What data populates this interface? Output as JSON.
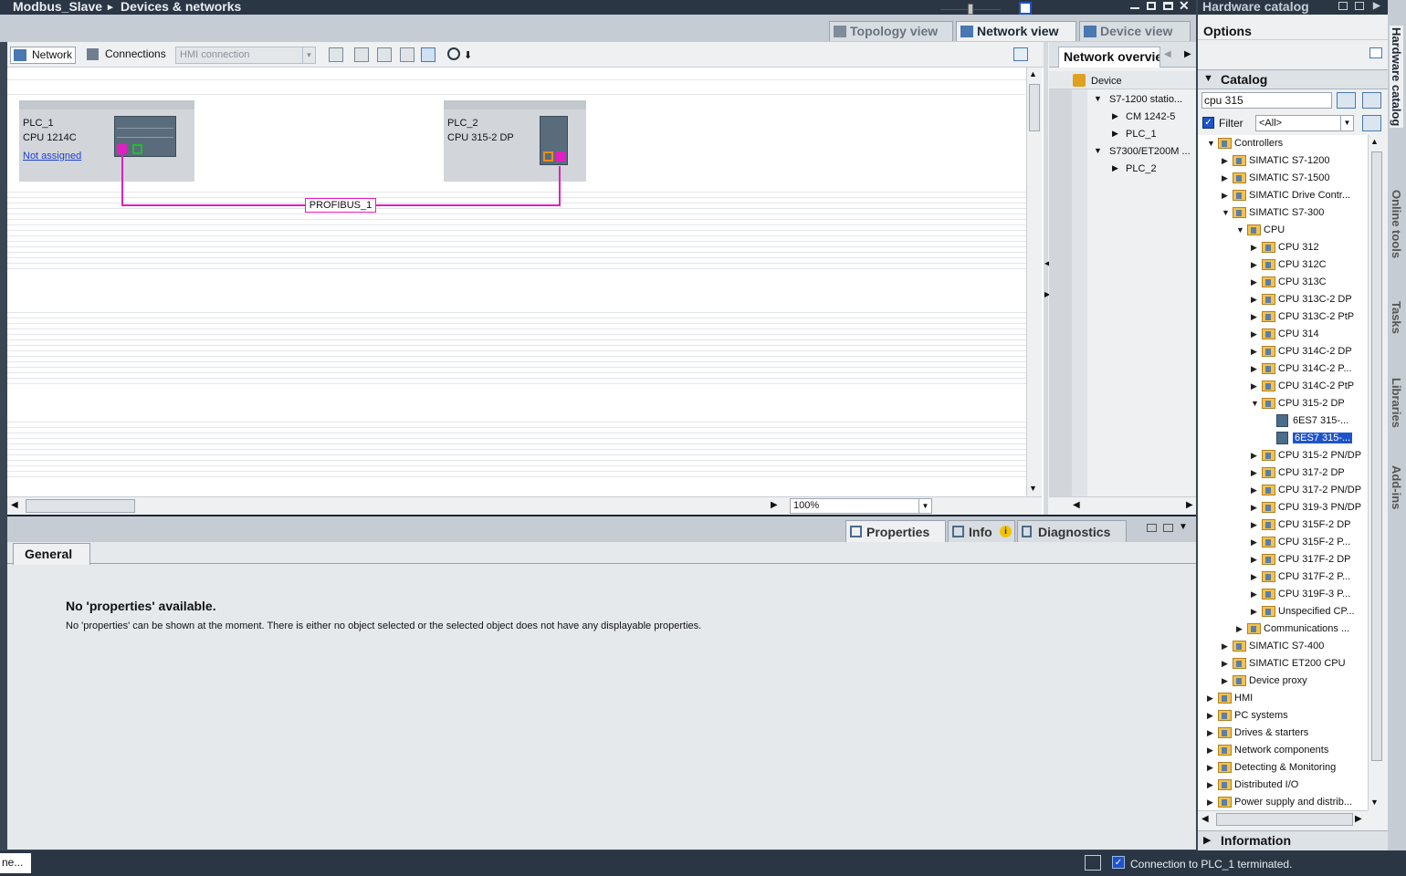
{
  "titlebar": {
    "project": "Modbus_Slave",
    "separator": "▸",
    "page": "Devices & networks",
    "min_icon": "minimize-icon",
    "close": "✕"
  },
  "view_tabs": [
    {
      "label": "Topology view",
      "icon": "topology-icon"
    },
    {
      "label": "Network view",
      "icon": "network-icon"
    },
    {
      "label": "Device view",
      "icon": "device-icon"
    }
  ],
  "toolbar": {
    "network_label": "Network",
    "connections_label": "Connections",
    "connection_type": "HMI connection"
  },
  "devices": [
    {
      "name": "PLC_1",
      "type": "CPU 1214C",
      "link": "Not assigned"
    },
    {
      "name": "PLC_2",
      "type": "CPU 315-2 DP"
    }
  ],
  "network": {
    "subnet_label": "PROFIBUS_1",
    "line_color": "#e020c0"
  },
  "zoom": {
    "value": "100%"
  },
  "overview": {
    "tab_label": "Network overvie",
    "column": "Device",
    "rows": [
      {
        "label": "S7-1200 statio...",
        "expanded": true
      },
      {
        "label": "CM 1242-5"
      },
      {
        "label": "PLC_1"
      },
      {
        "label": "S7300/ET200M ...",
        "expanded": true
      },
      {
        "label": "PLC_2"
      }
    ]
  },
  "bottom_tabs": {
    "properties": "Properties",
    "info": "Info",
    "info_badge": "i",
    "diagnostics": "Diagnostics"
  },
  "properties": {
    "general_tab": "General",
    "heading": "No 'properties' available.",
    "message": "No 'properties' can be shown at the moment. There is either no object selected or the selected object does not have any displayable properties."
  },
  "hardware_catalog": {
    "title": "Hardware catalog",
    "options": "Options",
    "catalog_label": "Catalog",
    "search_value": "cpu 315",
    "filter_label": "Filter",
    "filter_checked": true,
    "filter_value": "<All>",
    "information": "Information",
    "tree": [
      {
        "label": "Controllers",
        "level": 0,
        "state": "open",
        "kind": "folder"
      },
      {
        "label": "SIMATIC S7-1200",
        "level": 1,
        "state": "closed",
        "kind": "folder"
      },
      {
        "label": "SIMATIC S7-1500",
        "level": 1,
        "state": "closed",
        "kind": "folder"
      },
      {
        "label": "SIMATIC Drive Contr...",
        "level": 1,
        "state": "closed",
        "kind": "folder"
      },
      {
        "label": "SIMATIC S7-300",
        "level": 1,
        "state": "open",
        "kind": "folder"
      },
      {
        "label": "CPU",
        "level": 2,
        "state": "open",
        "kind": "folder"
      },
      {
        "label": "CPU 312",
        "level": 3,
        "state": "closed",
        "kind": "folder"
      },
      {
        "label": "CPU 312C",
        "level": 3,
        "state": "closed",
        "kind": "folder"
      },
      {
        "label": "CPU 313C",
        "level": 3,
        "state": "closed",
        "kind": "folder"
      },
      {
        "label": "CPU 313C-2 DP",
        "level": 3,
        "state": "closed",
        "kind": "folder"
      },
      {
        "label": "CPU 313C-2 PtP",
        "level": 3,
        "state": "closed",
        "kind": "folder"
      },
      {
        "label": "CPU 314",
        "level": 3,
        "state": "closed",
        "kind": "folder"
      },
      {
        "label": "CPU 314C-2 DP",
        "level": 3,
        "state": "closed",
        "kind": "folder"
      },
      {
        "label": "CPU 314C-2 P...",
        "level": 3,
        "state": "closed",
        "kind": "folder"
      },
      {
        "label": "CPU 314C-2 PtP",
        "level": 3,
        "state": "closed",
        "kind": "folder"
      },
      {
        "label": "CPU 315-2 DP",
        "level": 3,
        "state": "open",
        "kind": "folder"
      },
      {
        "label": "6ES7 315-...",
        "level": 4,
        "state": "none",
        "kind": "module"
      },
      {
        "label": "6ES7 315-...",
        "level": 4,
        "state": "none",
        "kind": "module",
        "selected": true
      },
      {
        "label": "CPU 315-2 PN/DP",
        "level": 3,
        "state": "closed",
        "kind": "folder"
      },
      {
        "label": "CPU 317-2 DP",
        "level": 3,
        "state": "closed",
        "kind": "folder"
      },
      {
        "label": "CPU 317-2 PN/DP",
        "level": 3,
        "state": "closed",
        "kind": "folder"
      },
      {
        "label": "CPU 319-3 PN/DP",
        "level": 3,
        "state": "closed",
        "kind": "folder"
      },
      {
        "label": "CPU 315F-2 DP",
        "level": 3,
        "state": "closed",
        "kind": "folder"
      },
      {
        "label": "CPU 315F-2 P...",
        "level": 3,
        "state": "closed",
        "kind": "folder"
      },
      {
        "label": "CPU 317F-2 DP",
        "level": 3,
        "state": "closed",
        "kind": "folder"
      },
      {
        "label": "CPU 317F-2 P...",
        "level": 3,
        "state": "closed",
        "kind": "folder"
      },
      {
        "label": "CPU 319F-3 P...",
        "level": 3,
        "state": "closed",
        "kind": "folder"
      },
      {
        "label": "Unspecified CP...",
        "level": 3,
        "state": "closed",
        "kind": "folder"
      },
      {
        "label": "Communications ...",
        "level": 2,
        "state": "closed",
        "kind": "folder"
      },
      {
        "label": "SIMATIC S7-400",
        "level": 1,
        "state": "closed",
        "kind": "folder"
      },
      {
        "label": "SIMATIC ET200 CPU",
        "level": 1,
        "state": "closed",
        "kind": "folder"
      },
      {
        "label": "Device proxy",
        "level": 1,
        "state": "closed",
        "kind": "folder"
      },
      {
        "label": "HMI",
        "level": 0,
        "state": "closed",
        "kind": "folder"
      },
      {
        "label": "PC systems",
        "level": 0,
        "state": "closed",
        "kind": "folder"
      },
      {
        "label": "Drives & starters",
        "level": 0,
        "state": "closed",
        "kind": "folder"
      },
      {
        "label": "Network components",
        "level": 0,
        "state": "closed",
        "kind": "folder"
      },
      {
        "label": "Detecting & Monitoring",
        "level": 0,
        "state": "closed",
        "kind": "folder"
      },
      {
        "label": "Distributed I/O",
        "level": 0,
        "state": "closed",
        "kind": "folder"
      },
      {
        "label": "Power supply and distrib...",
        "level": 0,
        "state": "closed",
        "kind": "folder"
      }
    ]
  },
  "side_tabs": [
    "Hardware catalog",
    "Online tools",
    "Tasks",
    "Libraries",
    "Add-ins"
  ],
  "status": {
    "left": "ne...",
    "message": "Connection to PLC_1 terminated."
  }
}
